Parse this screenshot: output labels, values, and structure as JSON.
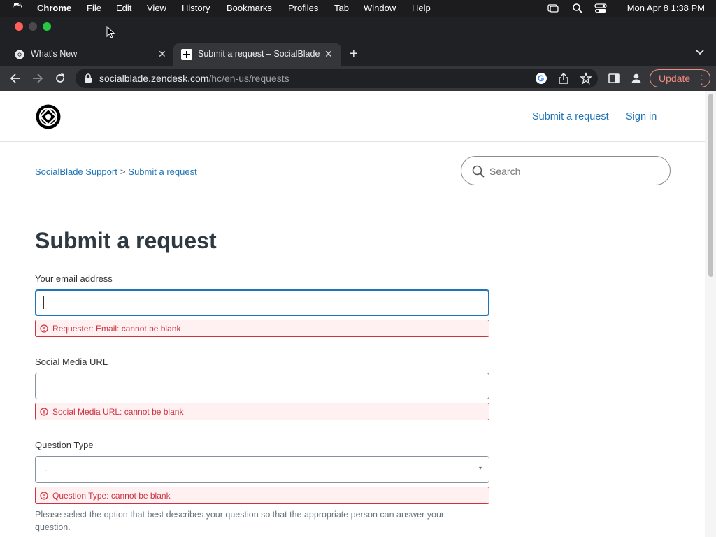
{
  "menubar": {
    "app": "Chrome",
    "items": [
      "File",
      "Edit",
      "View",
      "History",
      "Bookmarks",
      "Profiles",
      "Tab",
      "Window",
      "Help"
    ],
    "clock": "Mon Apr 8  1:38 PM"
  },
  "tabs": [
    {
      "label": "What's New",
      "icon": "chrome-icon"
    },
    {
      "label": "Submit a request – SocialBlade",
      "icon": "zendesk-plus-icon"
    }
  ],
  "address_bar": {
    "domain": "socialblade.zendesk.com",
    "path": "/hc/en-us/requests"
  },
  "update_label": "Update",
  "header": {
    "submit_link": "Submit a request",
    "signin_link": "Sign in"
  },
  "breadcrumb": {
    "home": "SocialBlade Support",
    "separator": ">",
    "current": "Submit a request"
  },
  "search": {
    "placeholder": "Search"
  },
  "page_title": "Submit a request",
  "form": {
    "email": {
      "label": "Your email address",
      "value": "",
      "error": "Requester: Email: cannot be blank"
    },
    "social_url": {
      "label": "Social Media URL",
      "value": "",
      "error": "Social Media URL: cannot be blank"
    },
    "question_type": {
      "label": "Question Type",
      "selected": "-",
      "error": "Question Type: cannot be blank",
      "hint": "Please select the option that best describes your question so that the appropriate person can answer your question."
    }
  },
  "colors": {
    "link": "#1f73b7",
    "error": "#cc3340",
    "error_bg": "#fff0f1",
    "update": "#f28b82"
  }
}
